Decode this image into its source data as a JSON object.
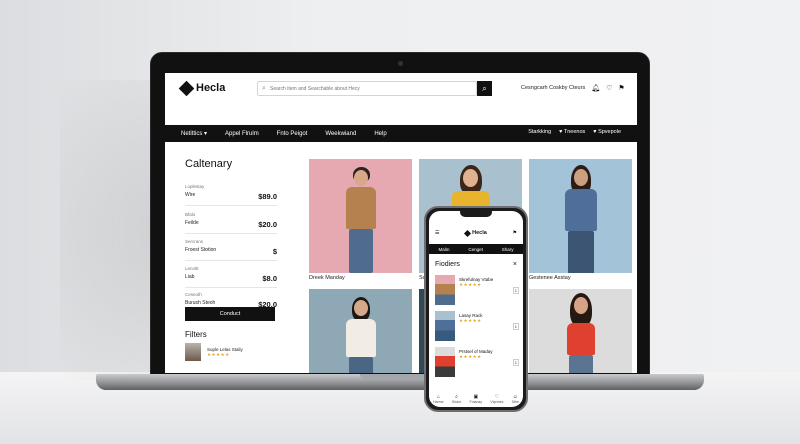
{
  "store": {
    "name": "Hecla",
    "search_placeholder": "Search item and Searchable about Hecy",
    "header_link": "Cesngcarh Coskby Cteurs"
  },
  "nav": {
    "items": [
      "Netittics",
      "Appel Flrulm",
      "Fnto Peigot",
      "Weekwiand",
      "Help"
    ],
    "right": [
      "Starkking",
      "Tneenos",
      "Spvepole"
    ]
  },
  "sidebar": {
    "title": "Caltenary",
    "rows": [
      {
        "sub": "Loplestay",
        "label": "Wire",
        "price": "$89.0"
      },
      {
        "sub": "Bfalo",
        "label": "Feilde",
        "price": "$20.0"
      },
      {
        "sub": "Sercrans",
        "label": "Froest Stotion",
        "price": "$"
      },
      {
        "sub": "Lenoltt",
        "label": "Liab",
        "price": "$8.0"
      },
      {
        "sub": "Ceseoth",
        "label": "Burush Steoh",
        "price": "$20.0"
      }
    ],
    "cta": "Conduct",
    "filters_title": "Filters",
    "mini_product": "Suple Lelas Staliy"
  },
  "products": [
    {
      "caption": "Dreek Manday"
    },
    {
      "caption": "Sogme"
    },
    {
      "caption": "Gestenee Asstay"
    }
  ],
  "phone": {
    "logo": "Hecla",
    "nav": [
      "Malm",
      "Cenget",
      "Shary"
    ],
    "title": "Fiodiers",
    "close": "×",
    "items": [
      {
        "name": "Skrefulnay Vtabe",
        "qty": "1"
      },
      {
        "name": "Lasay Rack",
        "qty": "1"
      },
      {
        "name": "Prstsel of Maday",
        "qty": "1"
      }
    ],
    "bottom": [
      "Harme",
      "Shaor",
      "Fotanay",
      "Vtprmes",
      "Sthe"
    ]
  },
  "colors": {
    "accent": "#111111",
    "star": "#e3a72a",
    "card_pink": "#e6a9b1",
    "card_blue": "#a9c0cf",
    "card_grey": "#8fa8b6"
  }
}
